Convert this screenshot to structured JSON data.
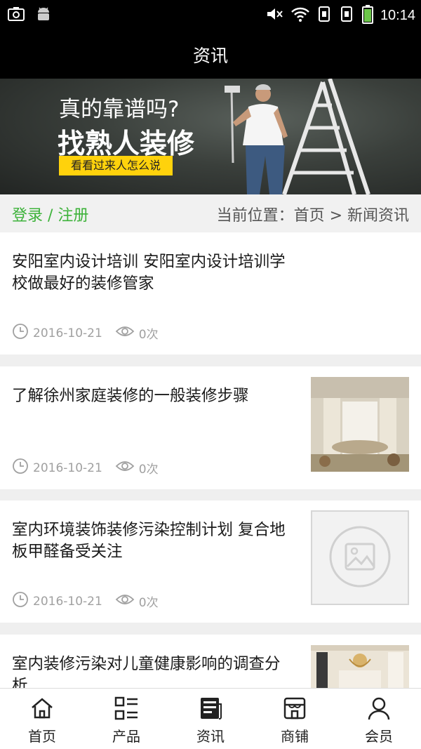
{
  "status_bar": {
    "time": "10:14"
  },
  "header": {
    "title": "资讯"
  },
  "banner": {
    "line1": "真的靠谱吗?",
    "line2": "找熟人装修",
    "button": "看看过来人怎么说"
  },
  "subheader": {
    "login_register": "登录 / 注册",
    "breadcrumb": "当前位置：首页 > 新闻资讯"
  },
  "news": [
    {
      "title": "安阳室内设计培训 安阳室内设计培训学校做最好的装修管家",
      "date": "2016-10-21",
      "views": "0次",
      "thumb": "none"
    },
    {
      "title": "了解徐州家庭装修的一般装修步骤",
      "date": "2016-10-21",
      "views": "0次",
      "thumb": "photo"
    },
    {
      "title": "室内环境装饰装修污染控制计划 复合地板甲醛备受关注",
      "date": "2016-10-21",
      "views": "0次",
      "thumb": "placeholder"
    },
    {
      "title": "室内装修污染对儿童健康影响的调查分析",
      "thumb": "photo"
    }
  ],
  "tabs": [
    {
      "label": "首页",
      "icon": "home-icon"
    },
    {
      "label": "产品",
      "icon": "product-grid-icon"
    },
    {
      "label": "资讯",
      "icon": "news-icon"
    },
    {
      "label": "商铺",
      "icon": "store-icon"
    },
    {
      "label": "会员",
      "icon": "member-icon"
    }
  ],
  "colors": {
    "accent_green": "#3db23a",
    "banner_yellow": "#ffd20c",
    "header_bg": "#000000"
  }
}
